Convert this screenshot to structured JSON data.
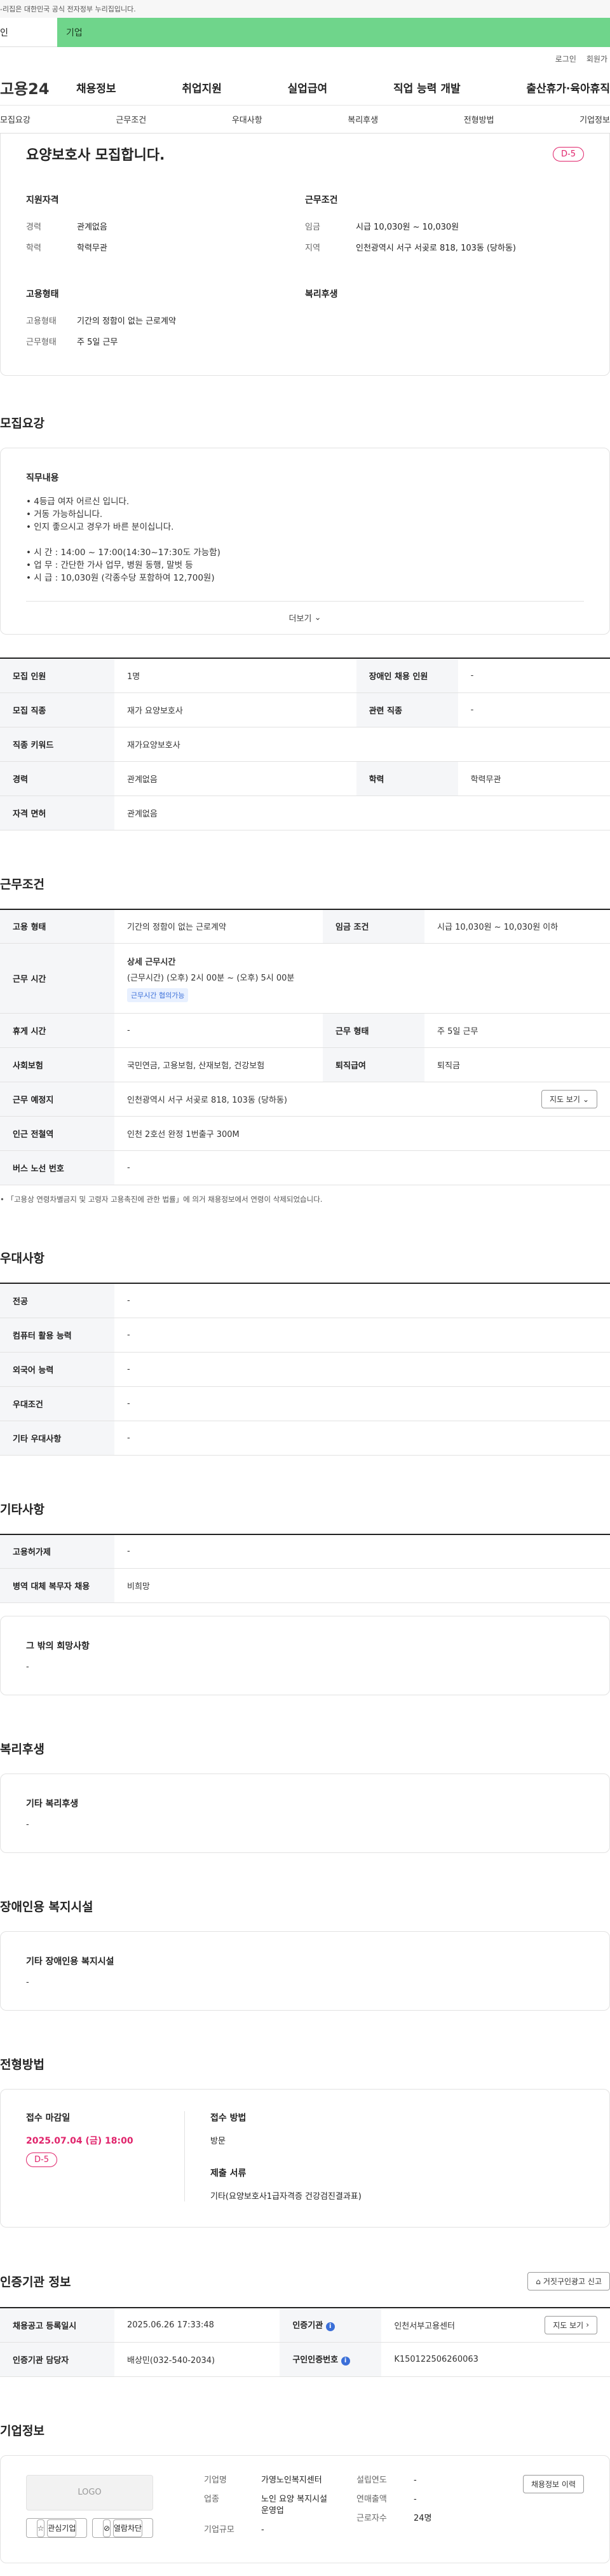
{
  "gov_banner": "-리집은 대한민국 공식 전자정부 누리집입니다.",
  "tabs": {
    "individual": "인",
    "business": "기업"
  },
  "util": {
    "login": "로그인",
    "signup": "회원가"
  },
  "gnb": {
    "logo": "고용24",
    "menu": [
      "채용정보",
      "취업지원",
      "실업급여",
      "직업 능력 개발",
      "출산휴가·육아휴직"
    ]
  },
  "subnav": [
    "모집요강",
    "근무조건",
    "우대사항",
    "복리후생",
    "전형방법",
    "기업정보"
  ],
  "summary": {
    "title": "요양보호사 모집합니다.",
    "dday": "D-5",
    "qual_h": "지원자격",
    "cond_h": "근무조건",
    "career_k": "경력",
    "career_v": "관계없음",
    "edu_k": "학력",
    "edu_v": "학력무관",
    "wage_k": "임금",
    "wage_v": "시급 10,030원 ~ 10,030원",
    "region_k": "지역",
    "region_v": "인천광역시 서구 서곶로 818, 103동 (당하동)",
    "emp_h": "고용형태",
    "welfare_h": "복리후생",
    "emptype_k": "고용형태",
    "emptype_v": "기간의 정함이 없는 근로계약",
    "worktype_k": "근무형태",
    "worktype_v": "주 5일 근무"
  },
  "recruit": {
    "title": "모집요강",
    "duty_h": "직무내용",
    "duty_lines": [
      "• 4등급 여자 어르신 입니다.",
      "• 거동 가능하십니다.",
      "• 인지 좋으시고 경우가 바른 분이십니다.",
      "",
      "• 시 간 : 14:00 ~ 17:00(14:30~17:30도 가능함)",
      "• 업 무 : 간단한 가사 업무, 병원 동행, 말벗 등",
      "• 시 급 : 10,030원 (각종수당 포함하여 12,700원)"
    ],
    "more": "더보기",
    "rows": [
      [
        "모집 인원",
        "1명",
        "장애인 채용 인원",
        "-"
      ],
      [
        "모집 직종",
        "재가 요양보호사",
        "관련 직종",
        "-"
      ],
      [
        "직종 키워드",
        "재가요양보호사"
      ],
      [
        "경력",
        "관계없음",
        "학력",
        "학력무관"
      ],
      [
        "자격 면허",
        "관계없음"
      ]
    ]
  },
  "conditions": {
    "title": "근무조건",
    "emp_type_k": "고용 형태",
    "emp_type_v": "기간의 정함이 없는 근로계약",
    "wage_k": "임금 조건",
    "wage_v": "시급 10,030원 ~ 10,030원 이하",
    "hours_k": "근무 시간",
    "hours_h": "상세 근무시간",
    "hours_v": "(근무시간) (오후) 2시 00분 ~ (오후) 5시 00분",
    "hours_tag": "근무시간 협의가능",
    "holiday_k": "휴게 시간",
    "holiday_v": "-",
    "worktype_k": "근무 형태",
    "worktype_v": "주 5일 근무",
    "insurance_k": "사회보험",
    "insurance_v": "국민연금, 고용보험, 산재보험, 건강보험",
    "retire_k": "퇴직급여",
    "retire_v": "퇴직금",
    "place_k": "근무 예정지",
    "place_v": "인천광역시 서구 서곶로 818, 103동 (당하동)",
    "map_btn": "지도 보기",
    "subway_k": "인근 전철역",
    "subway_v": "인천 2호선 완정 1번출구 300M",
    "bus_k": "버스 노선 번호",
    "bus_v": "-",
    "note": "• 「고용상 연령차별금지 및 고령자 고용촉진에 관한 법률」에 의거 채용정보에서 연령이 삭제되었습니다."
  },
  "preference": {
    "title": "우대사항",
    "rows": [
      [
        "전공",
        "-"
      ],
      [
        "컴퓨터 활용 능력",
        "-"
      ],
      [
        "외국어 능력",
        "-"
      ],
      [
        "우대조건",
        "-"
      ],
      [
        "기타 우대사항",
        "-"
      ]
    ]
  },
  "etc": {
    "title": "기타사항",
    "rows": [
      [
        "고용허가제",
        "-"
      ],
      [
        "병역 대체 복무자 채용",
        "비희망"
      ]
    ],
    "other_h": "그 밖의 희망사항",
    "other_v": "-"
  },
  "welfare": {
    "title": "복리후생",
    "h": "기타 복리후생",
    "v": "-"
  },
  "disabled": {
    "title": "장애인용 복지시설",
    "h": "기타 장애인용 복지시설",
    "v": "-"
  },
  "process": {
    "title": "전형방법",
    "deadline_h": "접수 마감일",
    "deadline_v": "2025.07.04 (금) 18:00",
    "dday": "D-5",
    "method_h": "접수 방법",
    "method_v": "방문",
    "docs_h": "제출 서류",
    "docs_v": "기타(요양보호사1급자격증 건강검진결과표)"
  },
  "agency": {
    "title": "인증기관 정보",
    "report_btn": "거짓구인광고 신고",
    "reg_k": "채용공고 등록일시",
    "reg_v": "2025.06.26 17:33:48",
    "org_k": "인증기관",
    "org_v": "인천서부고용센터",
    "map_btn": "지도 보기",
    "mgr_k": "인증기관 담당자",
    "mgr_v": "배상민(032-540-2034)",
    "num_k": "구인인증번호",
    "num_v": "K150122506260063"
  },
  "company": {
    "title": "기업정보",
    "logo": "LOGO",
    "fav_btn": "관심기업",
    "block_btn": "열람차단",
    "history_btn": "채용정보 이력",
    "name_k": "기업명",
    "name_v": "가영노인복지센터",
    "industry_k": "업종",
    "industry_v": "노인 요양 복지시설 운영업",
    "size_k": "기업규모",
    "size_v": "-",
    "year_k": "설립연도",
    "year_v": "-",
    "sales_k": "연매출액",
    "sales_v": "-",
    "staff_k": "근로자수",
    "staff_v": "24명"
  }
}
